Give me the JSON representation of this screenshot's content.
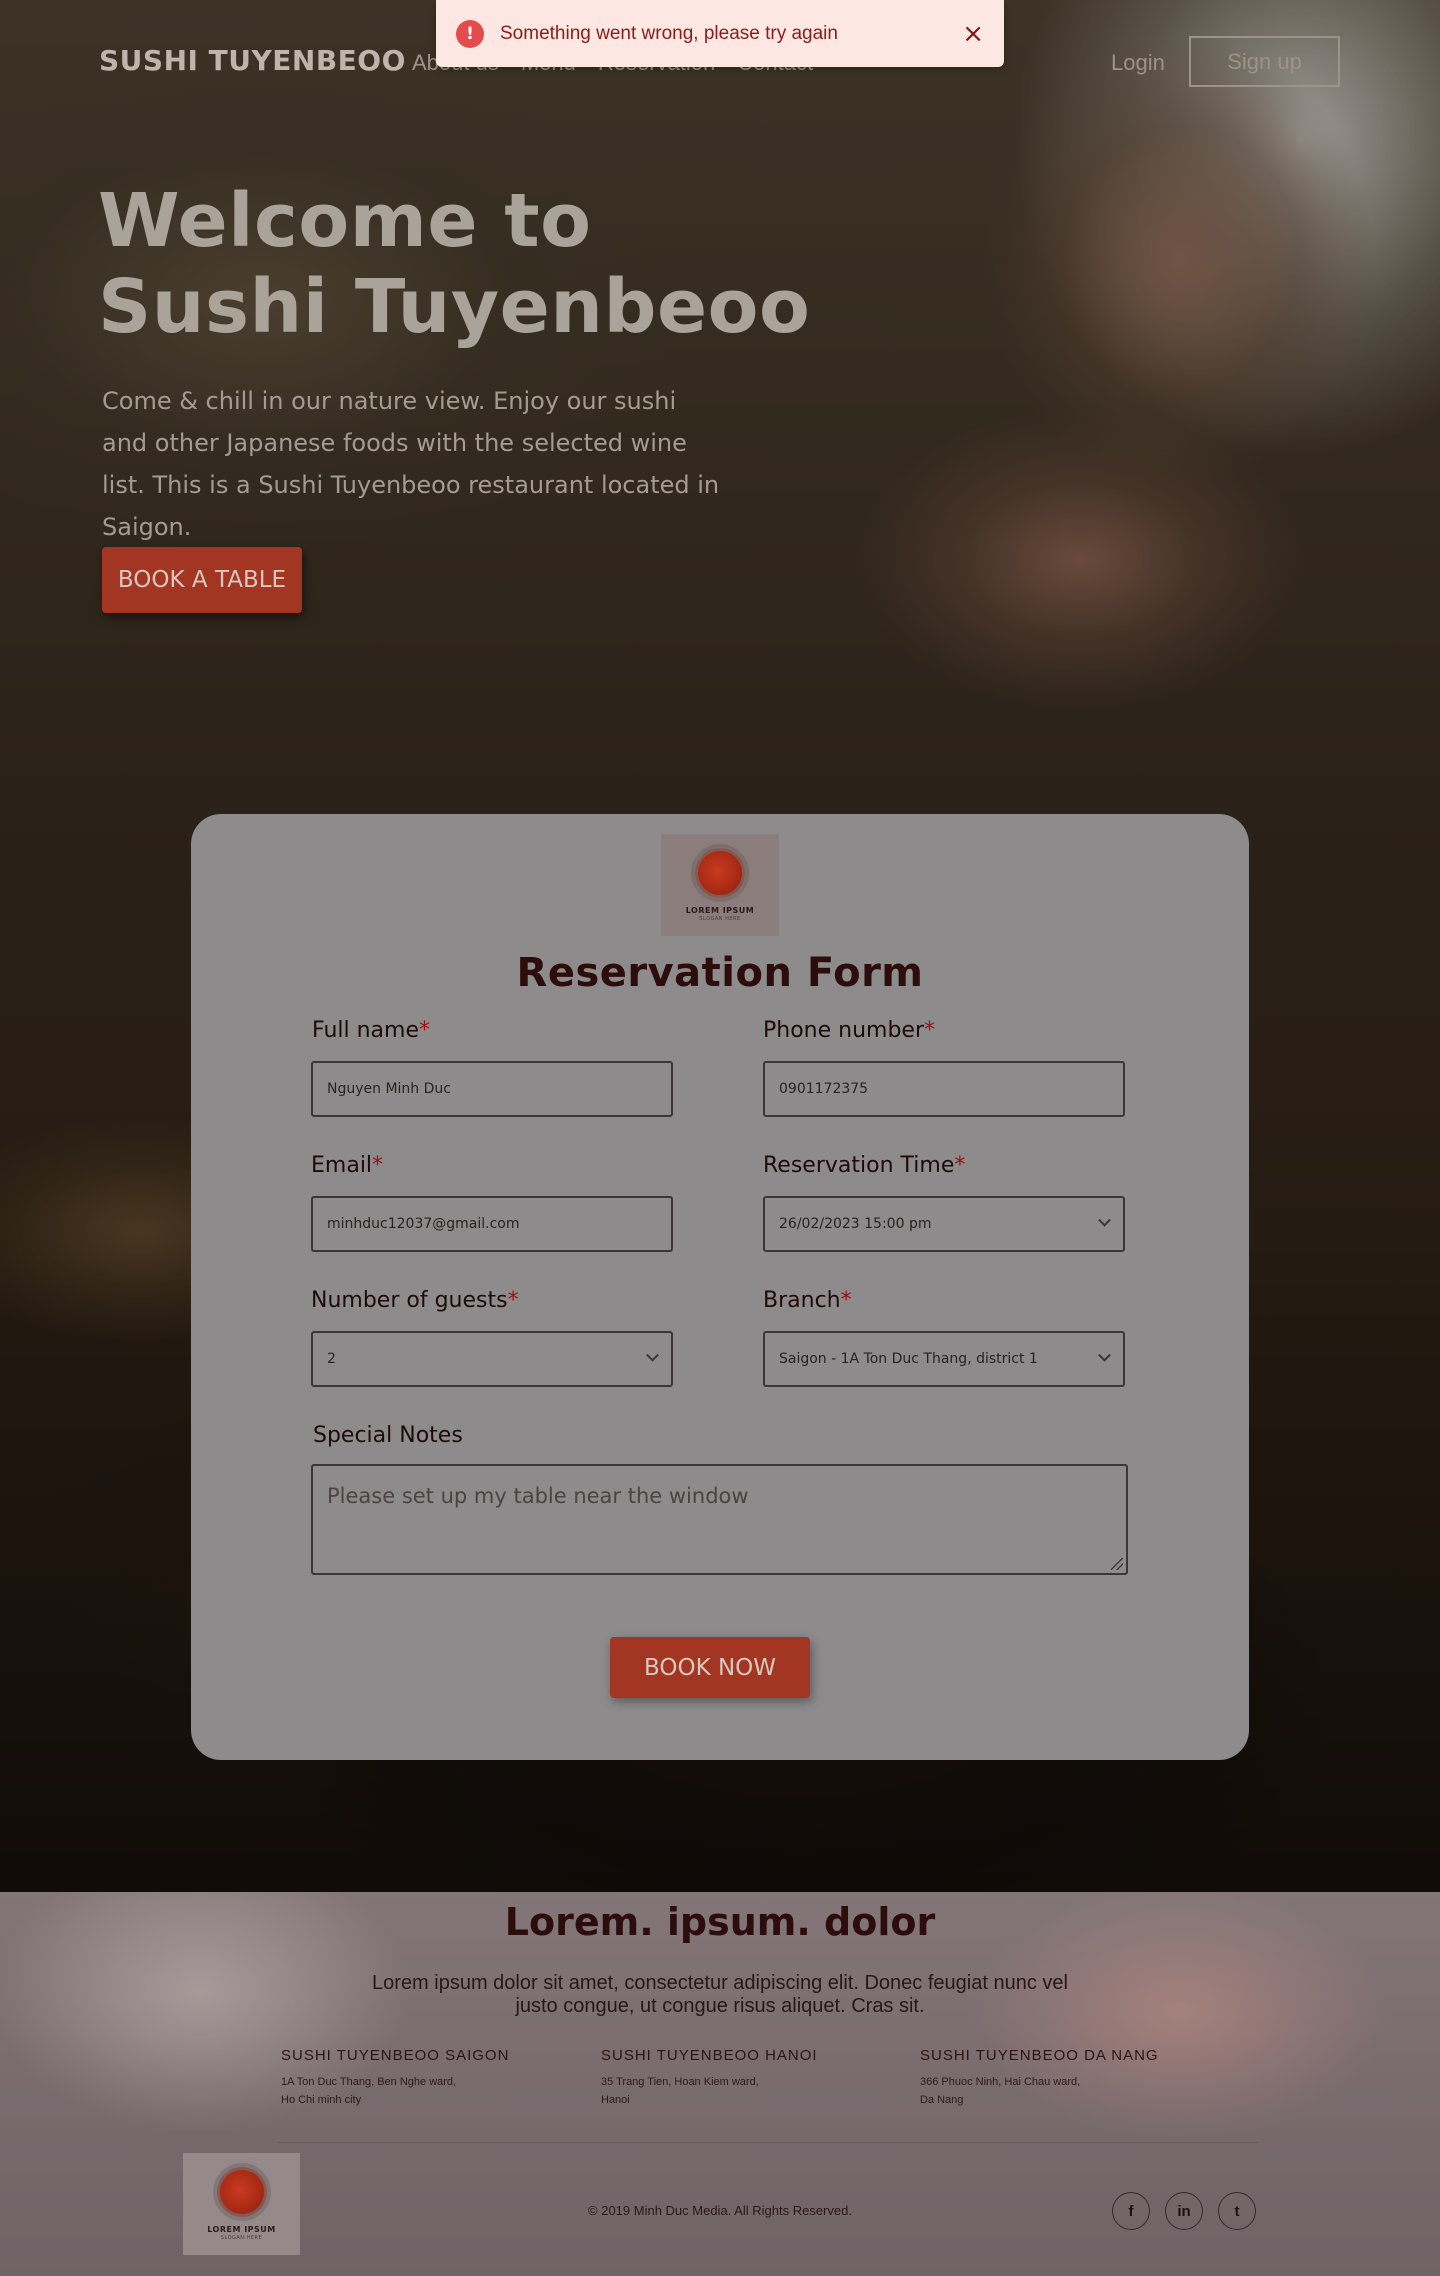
{
  "toast": {
    "icon": "alert-circle-icon",
    "message": "Something went wrong, please try again",
    "close_icon": "×"
  },
  "nav": {
    "brand": "SUSHI TUYENBEOO",
    "links": [
      "About us",
      "Menu",
      "Reservation",
      "Contact"
    ],
    "login": "Login",
    "signup": "Sign up"
  },
  "hero": {
    "title_line1": "Welcome to",
    "title_line2": "Sushi Tuyenbeoo",
    "description": "Come & chill in our nature view. Enjoy our sushi and other Japanese foods with the selected wine list. This is a Sushi Tuyenbeoo restaurant located in Saigon.",
    "cta": "BOOK A TABLE"
  },
  "form": {
    "logo_text": "LOREM IPSUM",
    "logo_slogan": "SLOGAN HERE",
    "title": "Reservation Form",
    "required_mark": "*",
    "full_name": {
      "label": "Full name",
      "value": "Nguyen Minh Duc"
    },
    "phone": {
      "label": "Phone number",
      "value": "0901172375"
    },
    "email": {
      "label": "Email",
      "value": "minhduc12037@gmail.com"
    },
    "reservation_time": {
      "label": "Reservation Time",
      "value": "26/02/2023 15:00 pm"
    },
    "guests": {
      "label": "Number of guests",
      "value": "2"
    },
    "branch": {
      "label": "Branch",
      "value": "Saigon - 1A Ton Duc Thang, district 1"
    },
    "notes": {
      "label": "Special Notes",
      "placeholder": "Please set up my table near the window"
    },
    "submit": "BOOK NOW"
  },
  "footer": {
    "title": "Lorem. ipsum. dolor",
    "description": "Lorem ipsum dolor sit amet, consectetur adipiscing elit. Donec feugiat nunc vel justo congue, ut congue risus aliquet. Cras sit.",
    "branches": [
      {
        "name": "SUSHI TUYENBEOO SAIGON",
        "address_line1": "1A Ton Duc Thang, Ben Nghe ward,",
        "address_line2": "Ho Chi minh city"
      },
      {
        "name": "SUSHI TUYENBEOO HANOI",
        "address_line1": "35 Trang Tien, Hoan Kiem ward,",
        "address_line2": "Hanoi"
      },
      {
        "name": "SUSHI TUYENBEOO DA NANG",
        "address_line1": "366 Phuoc Ninh, Hai Chau ward,",
        "address_line2": "Da Nang"
      }
    ],
    "logo_text": "LOREM IPSUM",
    "logo_slogan": "SLOGAN HERE",
    "copyright": "© 2019 Minh Duc Media. All Rights Reserved.",
    "social": [
      {
        "icon": "facebook-icon",
        "glyph": "f"
      },
      {
        "icon": "linkedin-icon",
        "glyph": "in"
      },
      {
        "icon": "twitter-icon",
        "glyph": "t"
      }
    ]
  },
  "colors": {
    "accent": "#a23623",
    "toast_bg": "#fde7e2",
    "toast_icon": "#e44b4b",
    "card_bg": "#8d8b8b",
    "title_dark": "#2d0c0c"
  }
}
